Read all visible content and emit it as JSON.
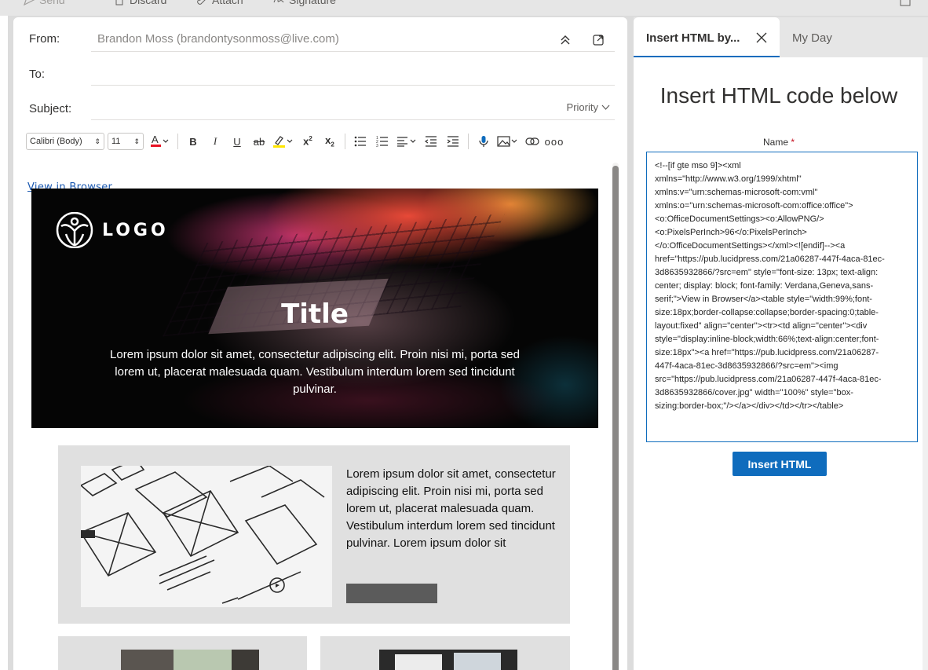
{
  "toolbar_top": {
    "send": "Send",
    "discard": "Discard",
    "attach": "Attach",
    "signature": "Signature"
  },
  "compose": {
    "from_label": "From:",
    "from_value": "Brandon Moss (brandontysonmoss@live.com)",
    "to_label": "To:",
    "subject_label": "Subject:",
    "priority_label": "Priority",
    "font_family": "Calibri (Body)",
    "font_size": "11"
  },
  "email": {
    "view_in_browser": "View in Browser",
    "logo_text": "LOGO",
    "hero_title": "Title",
    "hero_text": "Lorem ipsum dolor sit amet, consectetur adipiscing elit. Proin nisi mi, porta sed lorem ut, placerat malesuada quam. Vestibulum interdum lorem sed tincidunt pulvinar.",
    "card_text": "Lorem ipsum dolor sit amet, consectetur adipiscing elit. Proin nisi mi, porta sed lorem ut, placerat malesuada quam. Vestibulum interdum lorem sed tincidunt pulvinar.  Lorem ipsum dolor sit"
  },
  "pane": {
    "tab_active": "Insert HTML by...",
    "tab_other": "My Day",
    "title": "Insert HTML code below",
    "name_label": "Name",
    "required_mark": "*",
    "code": "<!--[if gte mso 9]><xml\nxmlns=\"http://www.w3.org/1999/xhtml\"\nxmlns:v=\"urn:schemas-microsoft-com:vml\"\nxmlns:o=\"urn:schemas-microsoft-com:office:office\">\n<o:OfficeDocumentSettings><o:AllowPNG/>\n<o:PixelsPerInch>96</o:PixelsPerInch>\n</o:OfficeDocumentSettings></xml><![endif]--><a\nhref=\"https://pub.lucidpress.com/21a06287-447f-4aca-81ec-\n3d8635932866/?src=em\" style=\"font-size: 13px; text-align:\ncenter; display: block; font-family: Verdana,Geneva,sans-\nserif;\">View in Browser</a><table style=\"width:99%;font-\nsize:18px;border-collapse:collapse;border-spacing:0;table-\nlayout:fixed\" align=\"center\"><tr><td align=\"center\"><div\nstyle=\"display:inline-block;width:66%;text-align:center;font-\nsize:18px\"><a href=\"https://pub.lucidpress.com/21a06287-\n447f-4aca-81ec-3d8635932866/?src=em\"><img\nsrc=\"https://pub.lucidpress.com/21a06287-447f-4aca-81ec-\n3d8635932866/cover.jpg\" width=\"100%\" style=\"box-\nsizing:border-box;\"/></a></div></td></tr></table>",
    "insert_button": "Insert HTML"
  },
  "colors": {
    "accent": "#0f6cbd",
    "required": "#c50f1f",
    "link": "#1a58b0"
  }
}
